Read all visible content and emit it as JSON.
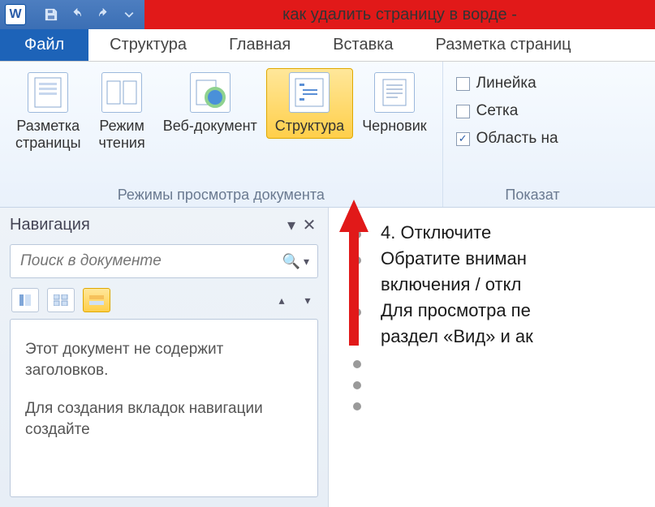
{
  "title": "как удалить страницу в ворде -",
  "tabs": {
    "file": "Файл",
    "items": [
      "Структура",
      "Главная",
      "Вставка",
      "Разметка страниц"
    ]
  },
  "ribbon": {
    "views": [
      {
        "label": "Разметка\nстраницы",
        "name": "view-print-layout",
        "icon": "page-layout"
      },
      {
        "label": "Режим\nчтения",
        "name": "view-reading",
        "icon": "reading"
      },
      {
        "label": "Веб-документ",
        "name": "view-web",
        "icon": "web"
      },
      {
        "label": "Структура",
        "name": "view-outline",
        "icon": "outline",
        "selected": true
      },
      {
        "label": "Черновик",
        "name": "view-draft",
        "icon": "draft"
      }
    ],
    "views_group_label": "Режимы просмотра документа",
    "show": {
      "ruler": {
        "label": "Линейка",
        "checked": false
      },
      "grid": {
        "label": "Сетка",
        "checked": false
      },
      "navpane": {
        "label": "Область на",
        "checked": true
      }
    },
    "show_group_label": "Показат"
  },
  "nav": {
    "title": "Навигация",
    "search_placeholder": "Поиск в документе",
    "empty_msg1": "Этот документ не содержит заголовков.",
    "empty_msg2": "Для создания вкладок навигации создайте"
  },
  "doc": {
    "lines": [
      "4.        Отключите",
      "Обратите вниман",
      "включения / откл",
      "Для просмотра пе",
      "раздел «Вид» и ак"
    ]
  }
}
